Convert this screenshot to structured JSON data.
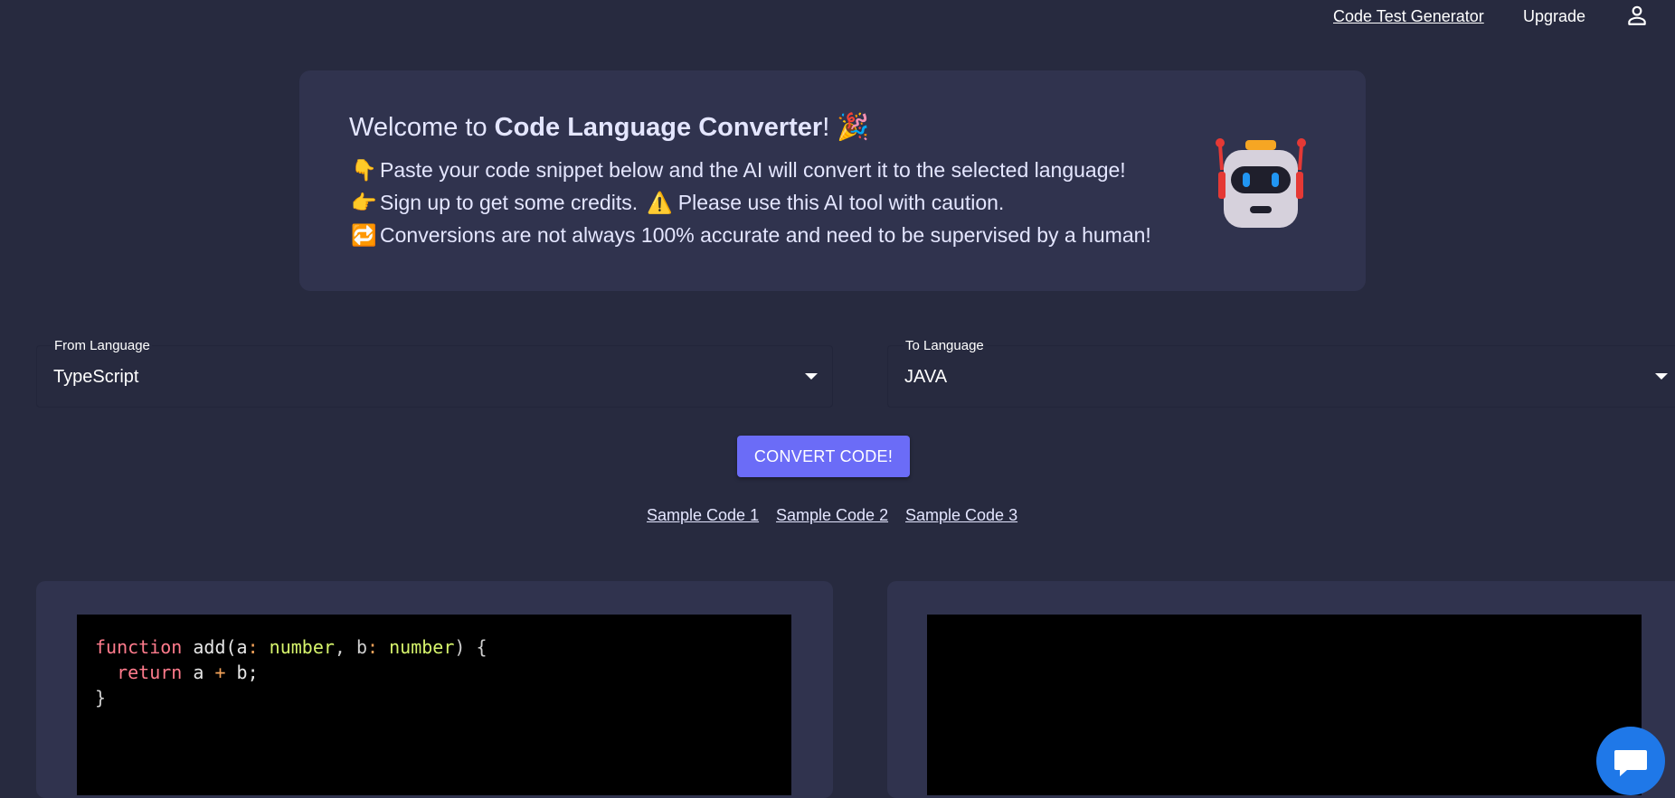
{
  "nav": {
    "code_test_generator": "Code Test Generator",
    "upgrade": "Upgrade",
    "account_icon": "person-outline-icon"
  },
  "welcome": {
    "title_prefix": "Welcome to ",
    "title_strong": "Code Language Converter",
    "title_suffix": "!",
    "title_emoji": "🎉",
    "line1_emoji": "👇",
    "line1": "Paste your code snippet below and the AI will convert it to the selected language!",
    "line2_emoji": "👉",
    "line2a": "Sign up to get some credits.",
    "line2_warn": "⚠️",
    "line2b": "Please use this AI tool with caution.",
    "line3_emoji": "🔁",
    "line3": "Conversions are not always 100% accurate and need to be supervised by a human!",
    "mascot": "robot-icon"
  },
  "from_select": {
    "label": "From Language",
    "value": "TypeScript"
  },
  "to_select": {
    "label": "To Language",
    "value": "JAVA"
  },
  "convert_button": "CONVERT CODE!",
  "samples": [
    "Sample Code 1",
    "Sample Code 2",
    "Sample Code 3"
  ],
  "editor_left": {
    "line1": {
      "kw": "function",
      "name": " add(a",
      "c1": ":",
      "t1": " number",
      "comma": ", b",
      "c2": ":",
      "t2": " number",
      "end": ") {"
    },
    "line2": {
      "indent": "  ",
      "kw": "return",
      "a": " a ",
      "op": "+",
      "b": " b;"
    },
    "line3": "}"
  },
  "editor_right": {
    "content": ""
  },
  "colors": {
    "background": "#272a3f",
    "card": "#30334e",
    "accent_button": "#6b6cf7",
    "chat_button": "#1f78e8",
    "editor_bg": "#000000"
  },
  "chat_icon": "chat-bubble-icon"
}
